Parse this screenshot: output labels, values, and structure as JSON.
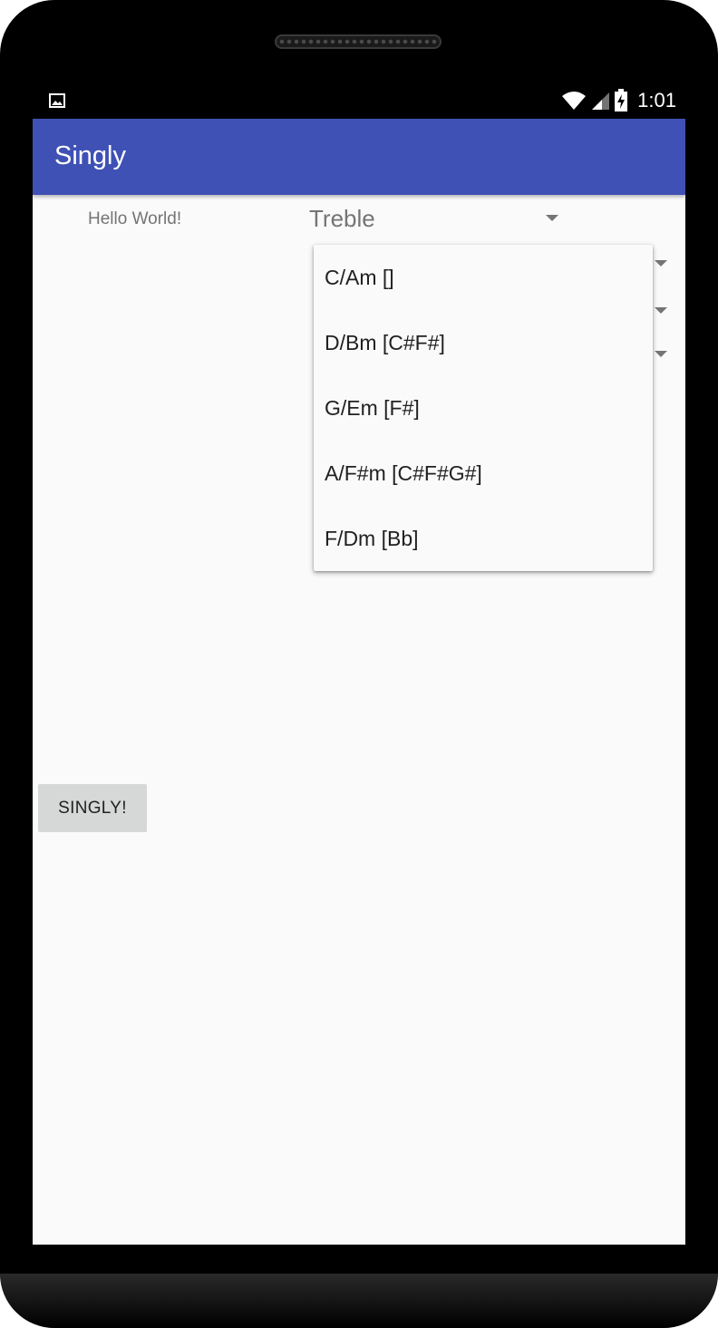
{
  "status_bar": {
    "time": "1:01",
    "icons": [
      "image-icon",
      "wifi-icon",
      "cell-signal-icon",
      "battery-charging-icon"
    ]
  },
  "app_bar": {
    "title": "Singly",
    "color": "#3f51b5"
  },
  "main": {
    "hello_text": "Hello World!",
    "clef_spinner": {
      "selected": "Treble"
    },
    "key_dropdown": {
      "options": [
        "C/Am []",
        "D/Bm [C#F#]",
        "G/Em [F#]",
        "A/F#m [C#F#G#]",
        "F/Dm [Bb]"
      ]
    },
    "singly_button_label": "SINGLY!"
  }
}
